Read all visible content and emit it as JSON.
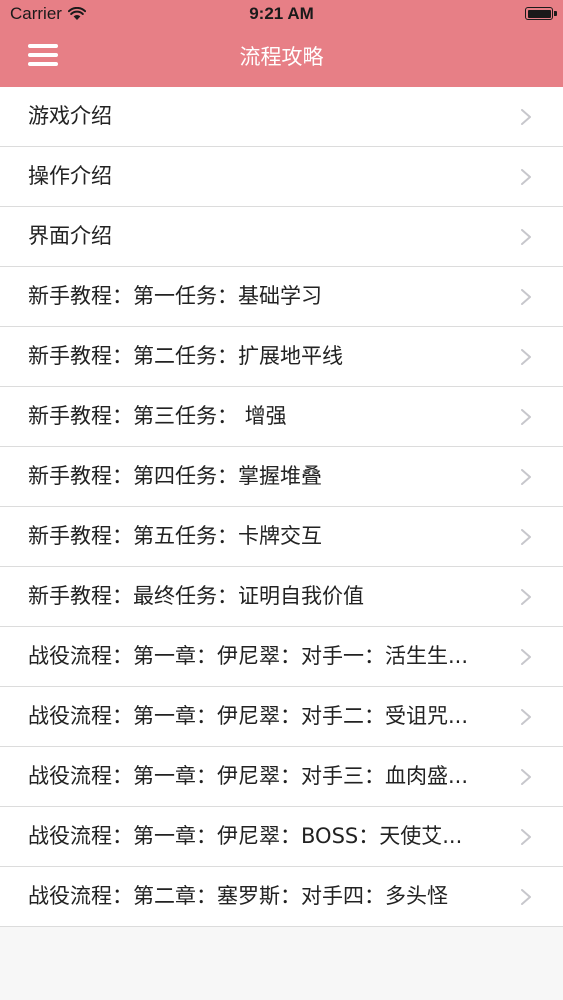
{
  "status_bar": {
    "carrier": "Carrier",
    "time": "9:21 AM",
    "icons": [
      "wifi-icon",
      "battery-icon"
    ]
  },
  "nav": {
    "title": "流程攻略",
    "menu_icon": "hamburger-menu-icon",
    "bar_color": "#e77f86"
  },
  "list": {
    "items": [
      {
        "label": "游戏介绍"
      },
      {
        "label": "操作介绍"
      },
      {
        "label": "界面介绍"
      },
      {
        "label": "新手教程：第一任务：基础学习"
      },
      {
        "label": "新手教程：第二任务：扩展地平线"
      },
      {
        "label": "新手教程：第三任务： 增强"
      },
      {
        "label": "新手教程：第四任务：掌握堆叠"
      },
      {
        "label": "新手教程：第五任务：卡牌交互"
      },
      {
        "label": "新手教程：最终任务：证明自我价值"
      },
      {
        "label": "战役流程：第一章：伊尼翠：对手一：活生生..."
      },
      {
        "label": "战役流程：第一章：伊尼翠：对手二：受诅咒..."
      },
      {
        "label": "战役流程：第一章：伊尼翠：对手三：血肉盛..."
      },
      {
        "label": "战役流程：第一章：伊尼翠：BOSS：天使艾..."
      },
      {
        "label": "战役流程：第二章：塞罗斯：对手四：多头怪"
      }
    ],
    "chevron_icon": "chevron-right-icon"
  }
}
